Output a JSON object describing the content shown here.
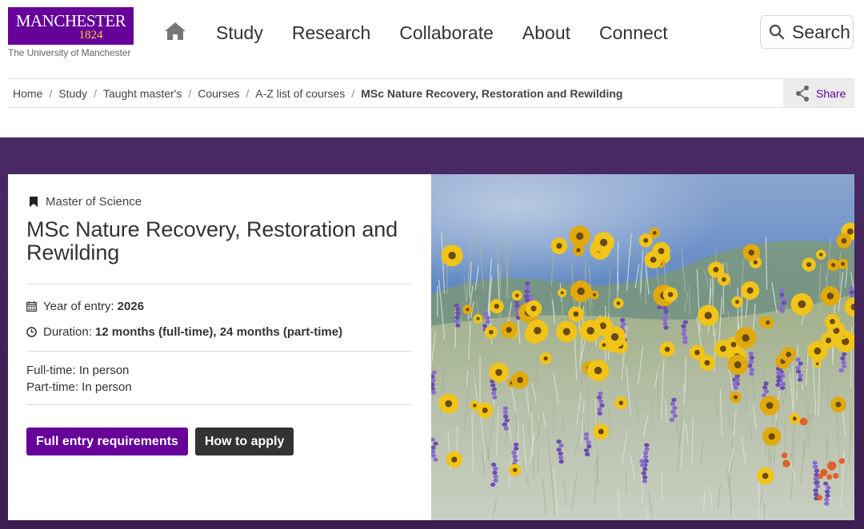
{
  "logo": {
    "wordmark": "MANCHESTER",
    "year": "1824",
    "subtitle": "The University of Manchester"
  },
  "nav": {
    "home_icon": "home-icon",
    "items": [
      "Study",
      "Research",
      "Collaborate",
      "About",
      "Connect"
    ],
    "search_label": "Search"
  },
  "breadcrumb": {
    "items": [
      "Home",
      "Study",
      "Taught master's",
      "Courses",
      "A-Z list of courses"
    ],
    "separator": "/",
    "current": "MSc Nature Recovery, Restoration and Rewilding",
    "share_label": "Share"
  },
  "course": {
    "type": "Master of Science",
    "title": "MSc Nature Recovery, Restoration and Rewilding",
    "year_label": "Year of entry:",
    "year_value": "2026",
    "duration_label": "Duration:",
    "duration_value": "12 months (full-time), 24 months (part-time)",
    "fulltime": "Full-time: In person",
    "parttime": "Part-time: In person",
    "btn_requirements": "Full entry requirements",
    "btn_apply": "How to apply"
  },
  "colors": {
    "brand_purple": "#660099",
    "brand_gold": "#ffcc33",
    "hero_bg": "#3e2256",
    "dark_button": "#333333"
  }
}
